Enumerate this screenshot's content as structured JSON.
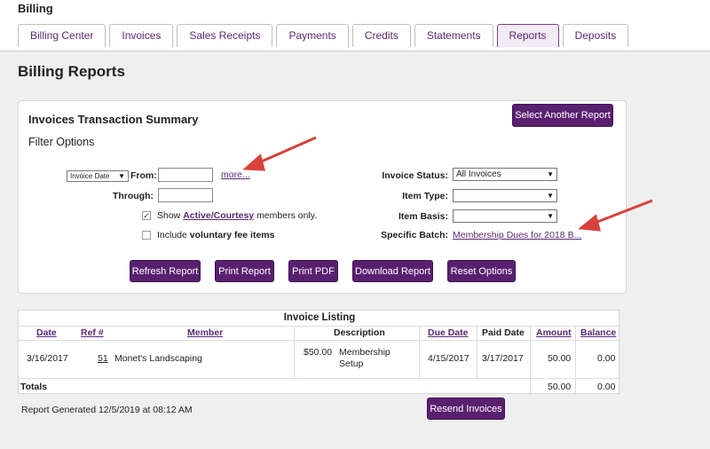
{
  "header": {
    "section_title": "Billing",
    "tabs": [
      {
        "label": "Billing Center"
      },
      {
        "label": "Invoices"
      },
      {
        "label": "Sales Receipts"
      },
      {
        "label": "Payments"
      },
      {
        "label": "Credits"
      },
      {
        "label": "Statements"
      },
      {
        "label": "Reports"
      },
      {
        "label": "Deposits"
      }
    ],
    "active_tab": "Reports"
  },
  "page_title": "Billing Reports",
  "report": {
    "title": "Invoices Transaction Summary",
    "select_another": "Select Another Report",
    "filter_title": "Filter Options",
    "date_type": "Invoice Date",
    "from_label": "From:",
    "from_value": "",
    "more_link": "more...",
    "through_label": "Through:",
    "through_value": "",
    "show_prefix": "Show",
    "show_link": "Active/Courtesy",
    "show_suffix": "members only.",
    "show_checked": true,
    "include_prefix": "Include",
    "include_bold": "voluntary fee items",
    "include_checked": false,
    "invoice_status_label": "Invoice Status:",
    "invoice_status_value": "All Invoices",
    "item_type_label": "Item Type:",
    "item_type_value": "",
    "item_basis_label": "Item Basis:",
    "item_basis_value": "",
    "specific_batch_label": "Specific Batch:",
    "specific_batch_value": "Membership Dues for 2018 B...",
    "buttons": {
      "refresh": "Refresh Report",
      "print": "Print Report",
      "pdf": "Print PDF",
      "download": "Download Report",
      "reset": "Reset Options"
    }
  },
  "listing": {
    "title": "Invoice Listing",
    "columns": [
      "Date",
      "Ref #",
      "Member",
      "Description",
      "Due Date",
      "Paid Date",
      "Amount",
      "Balance"
    ],
    "rows": [
      {
        "date": "3/16/2017",
        "ref": "51",
        "member": "Monet's Landscaping",
        "desc_amount": "$50.00",
        "desc_line1": "Membership",
        "desc_line2": "Setup",
        "due": "4/15/2017",
        "paid": "3/17/2017",
        "amount": "50.00",
        "balance": "0.00"
      }
    ],
    "totals": {
      "label": "Totals",
      "amount": "50.00",
      "balance": "0.00"
    }
  },
  "footer": {
    "generated": "Report Generated 12/5/2019 at 08:12 AM",
    "resend": "Resend Invoices"
  },
  "colors": {
    "accent": "#5a2070",
    "link": "#5a2a72",
    "annotation_arrow": "#d9413c"
  }
}
